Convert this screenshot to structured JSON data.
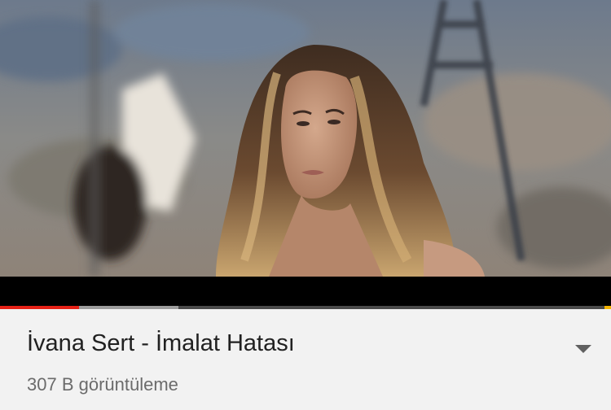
{
  "video": {
    "title": "İvana Sert - İmalat Hatası",
    "views": "307 B görüntüleme",
    "progress_played": 0.129,
    "progress_buffered": 0.292
  },
  "colors": {
    "played": "#e62117",
    "buffered": "#9c9c9c",
    "track": "#4a4a4a",
    "end_marker": "#f4b400"
  },
  "icons": {
    "expand": "chevron-down-icon"
  }
}
